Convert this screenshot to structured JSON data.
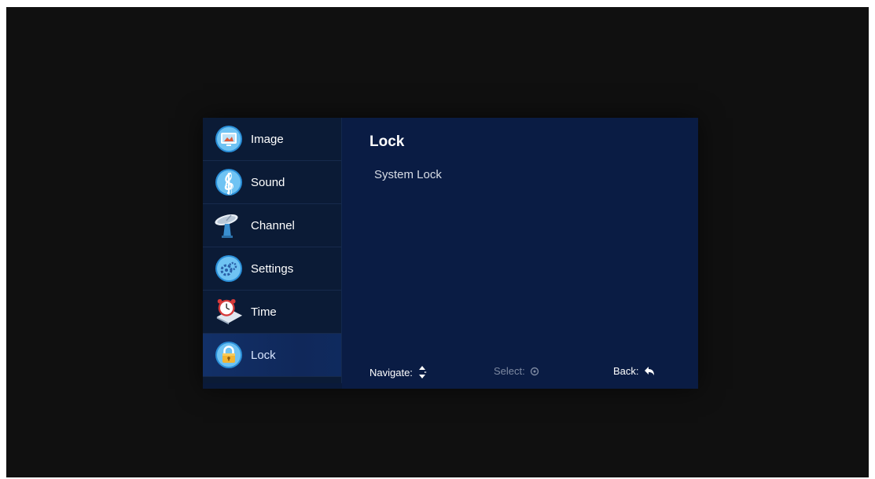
{
  "sidebar": {
    "items": [
      {
        "label": "Image",
        "icon": "image-icon"
      },
      {
        "label": "Sound",
        "icon": "sound-icon"
      },
      {
        "label": "Channel",
        "icon": "channel-icon"
      },
      {
        "label": "Settings",
        "icon": "settings-icon"
      },
      {
        "label": "Time",
        "icon": "time-icon"
      },
      {
        "label": "Lock",
        "icon": "lock-icon",
        "selected": true
      }
    ]
  },
  "content": {
    "title": "Lock",
    "options": [
      "System Lock"
    ]
  },
  "footer": {
    "navigate": "Navigate:",
    "select": "Select:",
    "back": "Back:"
  },
  "colors": {
    "panel": "#0a1c44",
    "sidebar": "#0b1b36",
    "selected": "#123068",
    "icon_blue": "#3aa7e6"
  }
}
